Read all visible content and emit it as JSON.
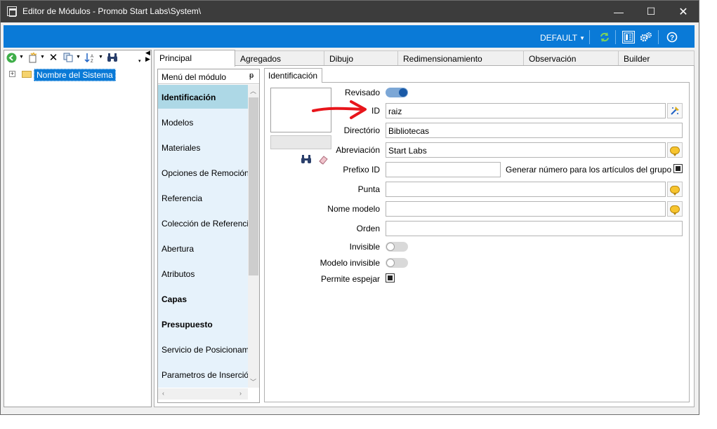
{
  "window": {
    "title": "Editor de Módulos - Promob Start Labs\\System\\",
    "minimize_glyph": "—",
    "maximize_glyph": "☐",
    "close_glyph": "✕"
  },
  "ribbon": {
    "preset_label": "DEFAULT",
    "icons": [
      "refresh-icon",
      "layout-icon",
      "settings-gears-icon",
      "help-icon"
    ],
    "accent_color": "#0a7ad7"
  },
  "tree_toolbar": {
    "icons": [
      "back-green-arrow-icon",
      "new-item-icon",
      "delete-icon",
      "copy-icon",
      "sort-icon",
      "find-icon"
    ]
  },
  "tree": {
    "root_label": "Nombre del Sistema"
  },
  "tabs": [
    {
      "label": "Principal",
      "active": true
    },
    {
      "label": "Agregados",
      "active": false
    },
    {
      "label": "Dibujo",
      "active": false
    },
    {
      "label": "Redimensionamiento",
      "active": false
    },
    {
      "label": "Observación",
      "active": false
    },
    {
      "label": "Builder",
      "active": false
    }
  ],
  "menu": {
    "header": "Menú del módulo",
    "pin_glyph": "ᵽ",
    "items": [
      {
        "label": "Identificación",
        "bold": true,
        "selected": true
      },
      {
        "label": "Modelos",
        "bold": false,
        "selected": false
      },
      {
        "label": "Materiales",
        "bold": false,
        "selected": false
      },
      {
        "label": "Opciones de Remoción",
        "bold": false,
        "selected": false
      },
      {
        "label": "Referencia",
        "bold": false,
        "selected": false
      },
      {
        "label": "Colección de Referencias",
        "bold": false,
        "selected": false
      },
      {
        "label": "Abertura",
        "bold": false,
        "selected": false
      },
      {
        "label": "Atributos",
        "bold": false,
        "selected": false
      },
      {
        "label": "Capas",
        "bold": true,
        "selected": false
      },
      {
        "label": "Presupuesto",
        "bold": true,
        "selected": false
      },
      {
        "label": "Servicio de Posicionamiento",
        "bold": false,
        "selected": false
      },
      {
        "label": "Parametros de Inserción",
        "bold": false,
        "selected": false
      }
    ]
  },
  "subtab": {
    "label": "Identificación"
  },
  "form": {
    "revisado": {
      "label": "Revisado",
      "on": true
    },
    "id": {
      "label": "ID",
      "value": "raiz"
    },
    "directorio": {
      "label": "Directório",
      "value": "Bibliotecas"
    },
    "abreviacion": {
      "label": "Abreviación",
      "value": "Start Labs"
    },
    "prefijo": {
      "label": "Prefixo ID",
      "value": ""
    },
    "generar": {
      "label": "Generar número para los artículos del grupo",
      "checked": true
    },
    "punta": {
      "label": "Punta",
      "value": ""
    },
    "nome_modelo": {
      "label": "Nome modelo",
      "value": ""
    },
    "orden": {
      "label": "Orden",
      "value": ""
    },
    "invisible": {
      "label": "Invisible",
      "on": false
    },
    "modelo_invisible": {
      "label": "Modelo invisible",
      "on": false
    },
    "permite_espejar": {
      "label": "Permite espejar",
      "checked": true
    }
  }
}
